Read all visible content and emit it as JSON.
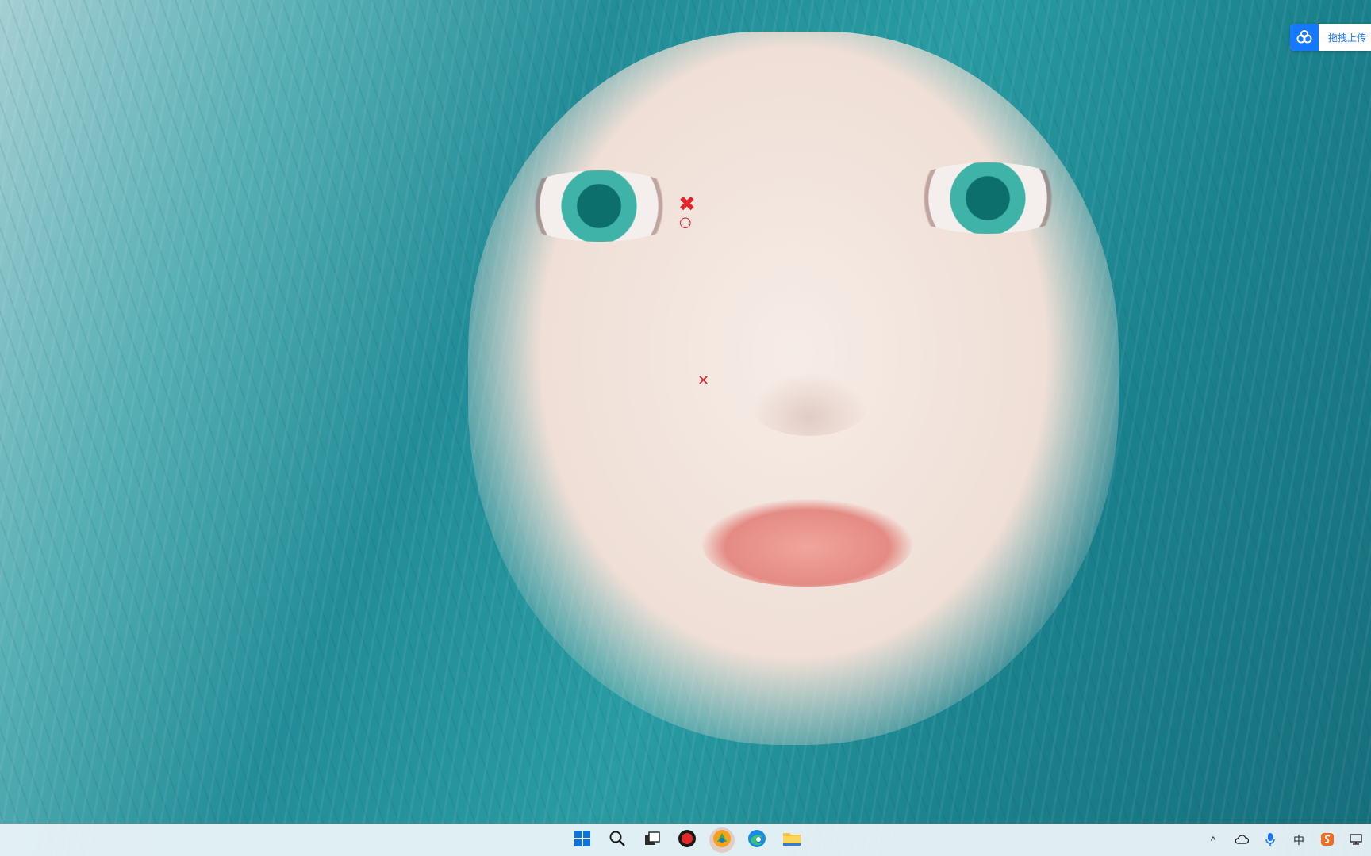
{
  "wallpaper": {
    "description_icon": "anime-portrait-wallpaper"
  },
  "overlay_markers": [
    {
      "glyph": "✖",
      "color": "#e3242b"
    },
    {
      "glyph": "○",
      "color": "#e3242b"
    },
    {
      "glyph": "✕",
      "color": "#e3242b"
    }
  ],
  "upload_widget": {
    "icon": "baidu-netdisk-icon",
    "label": "拖拽上传",
    "accent": "#1677ff"
  },
  "taskbar": {
    "background": "#e8f3f7",
    "pinned": [
      {
        "name": "start-button",
        "icon": "windows-logo-icon"
      },
      {
        "name": "search-button",
        "icon": "search-icon"
      },
      {
        "name": "task-view-button",
        "icon": "task-view-icon"
      },
      {
        "name": "recorder-app",
        "icon": "record-icon"
      },
      {
        "name": "app-round",
        "icon": "app-icon"
      },
      {
        "name": "edge-browser",
        "icon": "edge-icon"
      },
      {
        "name": "file-explorer",
        "icon": "folder-icon"
      }
    ],
    "tray": {
      "chevron": "^",
      "ime": "中"
    }
  }
}
